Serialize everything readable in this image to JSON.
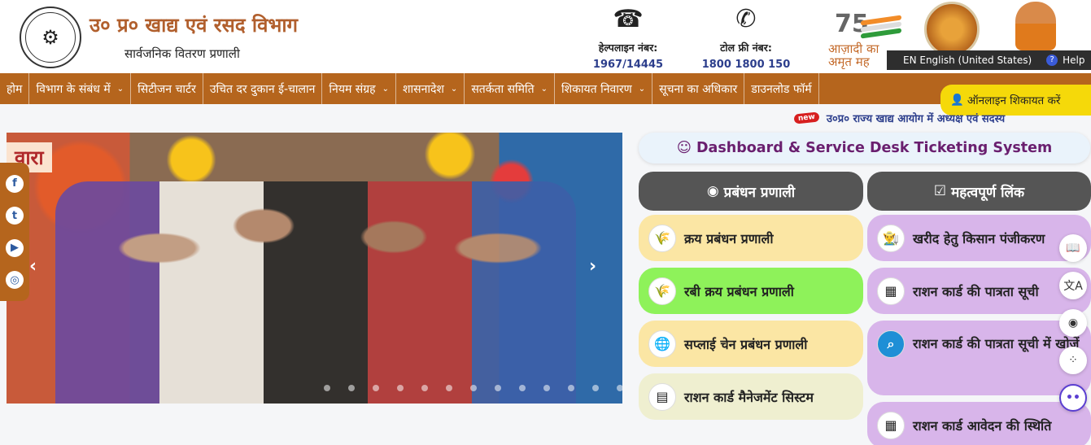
{
  "header": {
    "title": "उ० प्र० खाद्य एवं रसद विभाग",
    "subtitle": "सार्वजनिक वितरण प्रणाली",
    "emblem_text": "उत्तर प्रदेश सरकार",
    "helpline": {
      "label": "हेल्पलाइन नंबर:",
      "value": "1967/14445",
      "icon": "telephone-icon"
    },
    "tollfree": {
      "label": "टोल फ्री नंबर:",
      "value": "1800 1800 150",
      "icon": "phone-call-icon"
    },
    "azadi": {
      "number": "75",
      "text_line1": "आज़ादी का",
      "text_line2": "अमृत मह"
    }
  },
  "language_bar": {
    "language": "EN English (United States)",
    "help": "Help"
  },
  "nav": {
    "items": [
      {
        "label": "होम",
        "has_dropdown": false
      },
      {
        "label": "विभाग के संबंध में",
        "has_dropdown": true
      },
      {
        "label": "सिटीजन चार्टर",
        "has_dropdown": false
      },
      {
        "label": "उचित दर दुकान ई-चालान",
        "has_dropdown": false
      },
      {
        "label": "नियम संग्रह",
        "has_dropdown": true
      },
      {
        "label": "शासनादेश",
        "has_dropdown": true
      },
      {
        "label": "सतर्कता समिति",
        "has_dropdown": true
      },
      {
        "label": "शिकायत निवारण",
        "has_dropdown": true
      },
      {
        "label": "सूचना का अधिकार",
        "has_dropdown": false
      },
      {
        "label": "डाउनलोड फॉर्म",
        "has_dropdown": false
      }
    ],
    "complaint_button": "ऑनलाइन शिकायत करें"
  },
  "ticker": {
    "badge": "new",
    "text": "उ०प्र० राज्य खाद्य आयोग में अध्यक्ष एवं सदस्य"
  },
  "carousel": {
    "banner_text": "वारा",
    "prev": "‹",
    "next": "›",
    "slide_count": 13
  },
  "social": [
    {
      "name": "facebook-icon",
      "glyph": "f"
    },
    {
      "name": "twitter-icon",
      "glyph": "t"
    },
    {
      "name": "youtube-icon",
      "glyph": "▶"
    },
    {
      "name": "instagram-icon",
      "glyph": "◎"
    }
  ],
  "dashboard": {
    "label": "Dashboard & Service Desk Ticketing System"
  },
  "sections": {
    "management": "प्रबंधन प्रणाली",
    "links": "महत्वपूर्ण लिंक"
  },
  "management_cards": [
    {
      "label": "क्रय प्रबंधन प्रणाली",
      "color": "#fbe6a4"
    },
    {
      "label": "रबी क्रय प्रबंधन प्रणाली",
      "color": "#8ef25a"
    },
    {
      "label": "सप्लाई चेन प्रबंधन प्रणाली",
      "color": "#fbe6a4"
    },
    {
      "label": "राशन कार्ड मैनेजमेंट सिस्टम",
      "color": "#efefd0"
    }
  ],
  "link_cards": [
    {
      "label": "खरीद हेतु किसान पंजीकरण"
    },
    {
      "label": "राशन कार्ड की पात्रता सूची"
    },
    {
      "label": "राशन कार्ड की पात्रता सूची में खोजें"
    },
    {
      "label": "राशन कार्ड आवेदन की स्थिति"
    }
  ],
  "colors": {
    "brand": "#b5651d",
    "title": "#b15f2d",
    "accent_purple": "#6a1f6f",
    "yellow": "#f5d90a"
  }
}
